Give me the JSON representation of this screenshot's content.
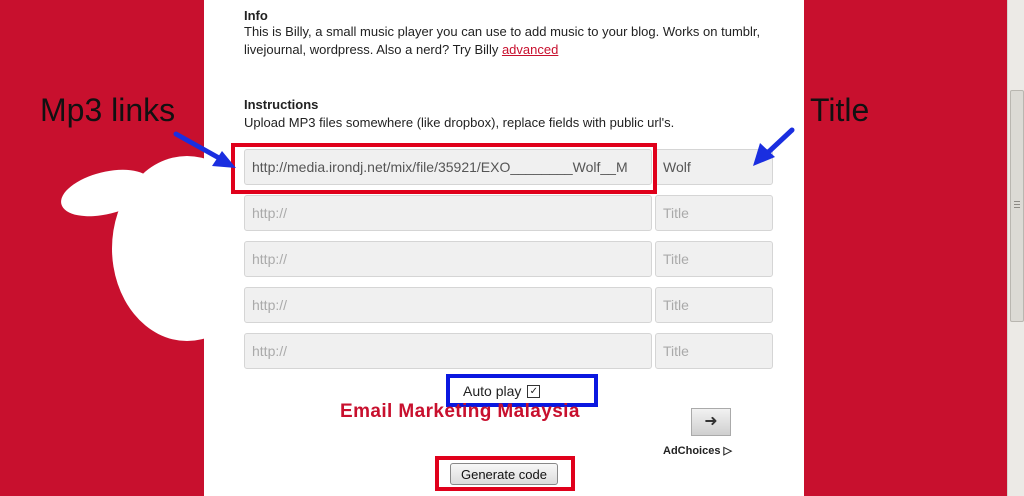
{
  "colors": {
    "background": "#c8102e",
    "highlight_red": "#e0001b",
    "highlight_blue": "#0a18e0",
    "arrow_blue": "#1a2ee0"
  },
  "info": {
    "heading": "Info",
    "text_before_link": "This is Billy, a small music player you can use to add music to your blog. Works on tumblr, livejournal, wordpress. Also a nerd? Try Billy ",
    "link": "advanced"
  },
  "instructions": {
    "heading": "Instructions",
    "text": "Upload MP3 files somewhere (like dropbox), replace fields with public url's."
  },
  "tracks": [
    {
      "url_value": "http://media.irondj.net/mix/file/35921/EXO________Wolf__M",
      "url_placeholder": "http://",
      "title_value": "Wolf",
      "title_placeholder": "Title"
    },
    {
      "url_value": "",
      "url_placeholder": "http://",
      "title_value": "",
      "title_placeholder": "Title"
    },
    {
      "url_value": "",
      "url_placeholder": "http://",
      "title_value": "",
      "title_placeholder": "Title"
    },
    {
      "url_value": "",
      "url_placeholder": "http://",
      "title_value": "",
      "title_placeholder": "Title"
    },
    {
      "url_value": "",
      "url_placeholder": "http://",
      "title_value": "",
      "title_placeholder": "Title"
    }
  ],
  "autoplay": {
    "label": "Auto play",
    "checked": true,
    "check_glyph": "✓"
  },
  "ad": {
    "text": "Email Marketing Malaysia",
    "arrow_icon": "➜",
    "adchoices": "AdChoices ▷"
  },
  "generate_button": "Generate code",
  "annotations": {
    "mp3_links": "Mp3 links",
    "title": "Title"
  }
}
